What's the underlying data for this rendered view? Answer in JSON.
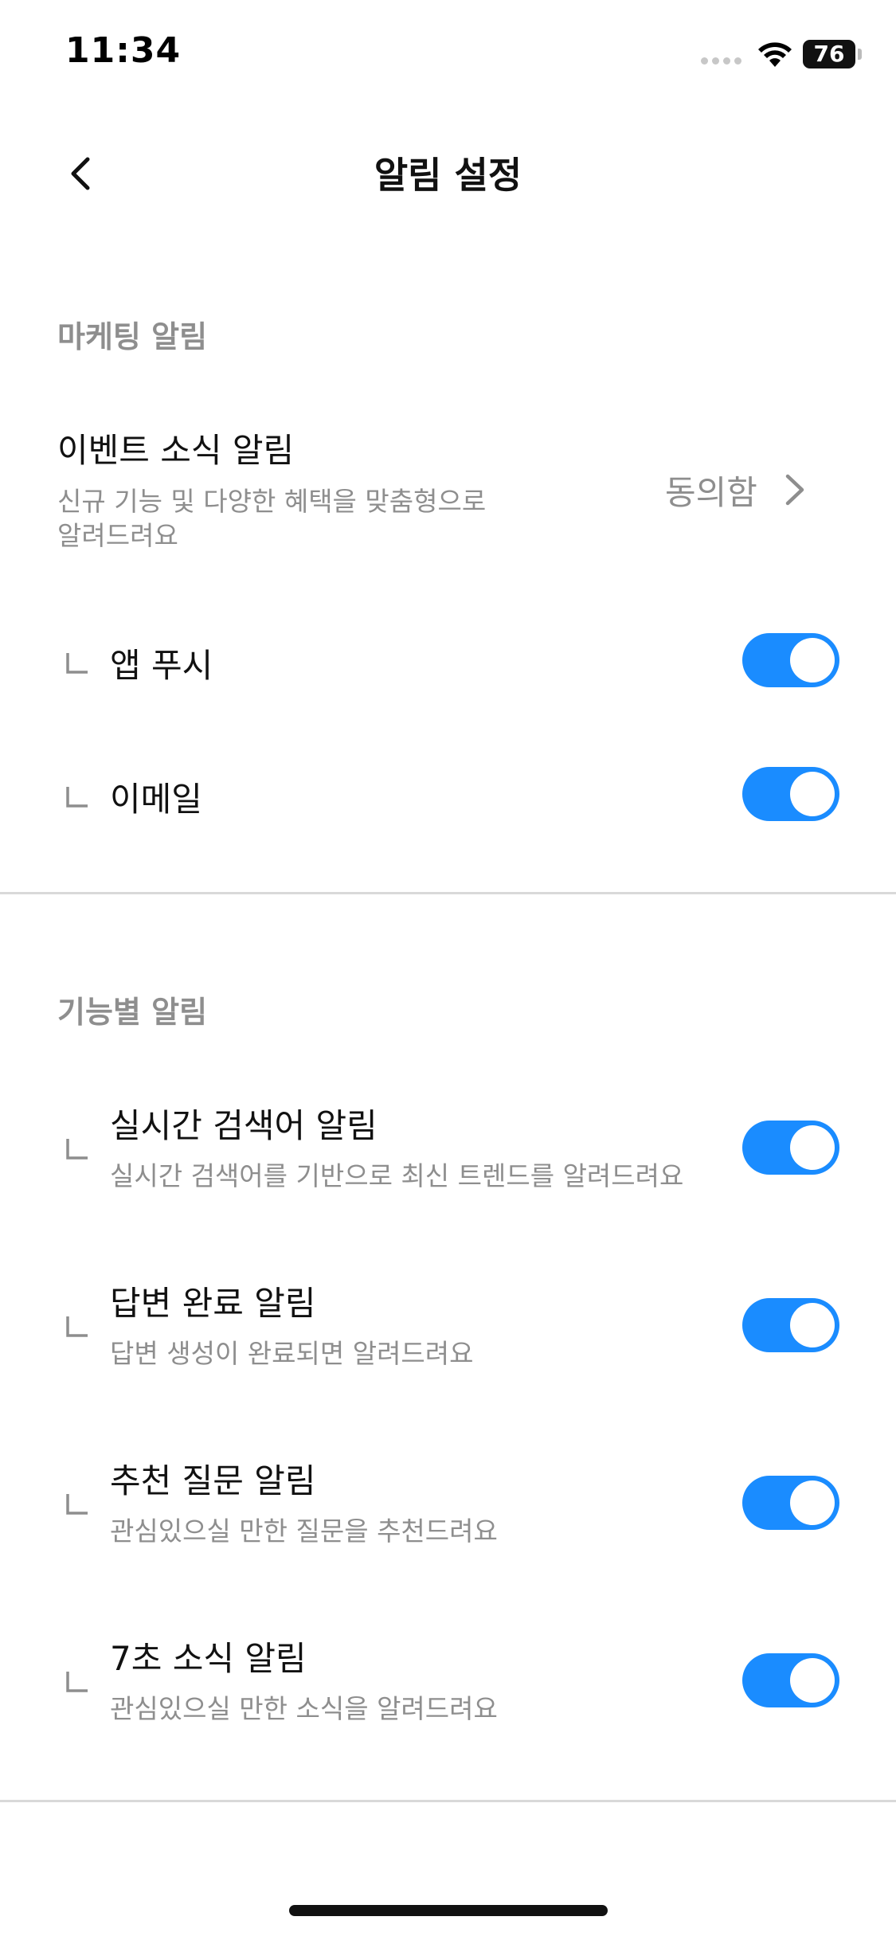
{
  "status_bar": {
    "time": "11:34",
    "battery": "76"
  },
  "nav": {
    "title": "알림 설정"
  },
  "marketing": {
    "section_title": "마케팅 알림",
    "event": {
      "title": "이벤트 소식 알림",
      "description_line1": "신규 기능 및 다양한 혜택을 맞춤형으로",
      "description_line2": "알려드려요",
      "status": "동의함"
    },
    "channels": [
      {
        "label": "앱 푸시",
        "enabled": true
      },
      {
        "label": "이메일",
        "enabled": true
      }
    ]
  },
  "features": {
    "section_title": "기능별 알림",
    "items": [
      {
        "title": "실시간 검색어 알림",
        "description": "실시간 검색어를 기반으로 최신 트렌드를 알려드려요",
        "enabled": true
      },
      {
        "title": "답변 완료 알림",
        "description": "답변 생성이 완료되면 알려드려요",
        "enabled": true
      },
      {
        "title": "추천 질문 알림",
        "description": "관심있으실 만한 질문을 추천드려요",
        "enabled": true
      },
      {
        "title": "7초 소식 알림",
        "description": "관심있으실 만한 소식을 알려드려요",
        "enabled": true
      }
    ]
  },
  "colors": {
    "accent": "#1a8cff",
    "secondary_text": "#8e8e8e",
    "divider": "#d9d9d9"
  }
}
